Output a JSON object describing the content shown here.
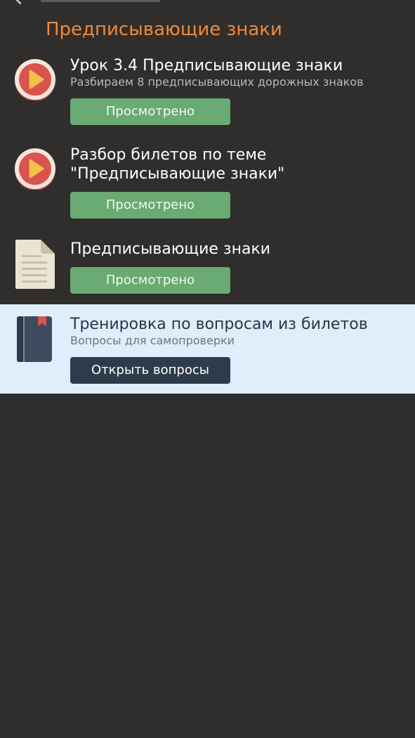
{
  "colors": {
    "background": "#2f2e2c",
    "section_title": "#f0893a",
    "viewed_button": "#6aaa73",
    "open_button": "#2e3b4b",
    "highlight_row": "#dfeefb",
    "play_icon": "#d9534f"
  },
  "header": {
    "back_icon": "chevron-left-icon"
  },
  "section": {
    "title": "Предписывающие знаки"
  },
  "items": [
    {
      "icon": "play-video-icon",
      "title": "Урок 3.4 Предписывающие знаки",
      "subtitle": "Разбираем  8 предписывающих дорожных знаков",
      "button": "Просмотрено"
    },
    {
      "icon": "play-video-icon",
      "title": "Разбор билетов по теме \"Предписывающие знаки\"",
      "button": "Просмотрено"
    },
    {
      "icon": "document-icon",
      "title": "Предписывающие знаки",
      "button": "Просмотрено"
    },
    {
      "icon": "book-icon",
      "title": "Тренировка по вопросам из билетов",
      "subtitle": "Вопросы для самопроверки",
      "button": "Открыть вопросы"
    }
  ]
}
